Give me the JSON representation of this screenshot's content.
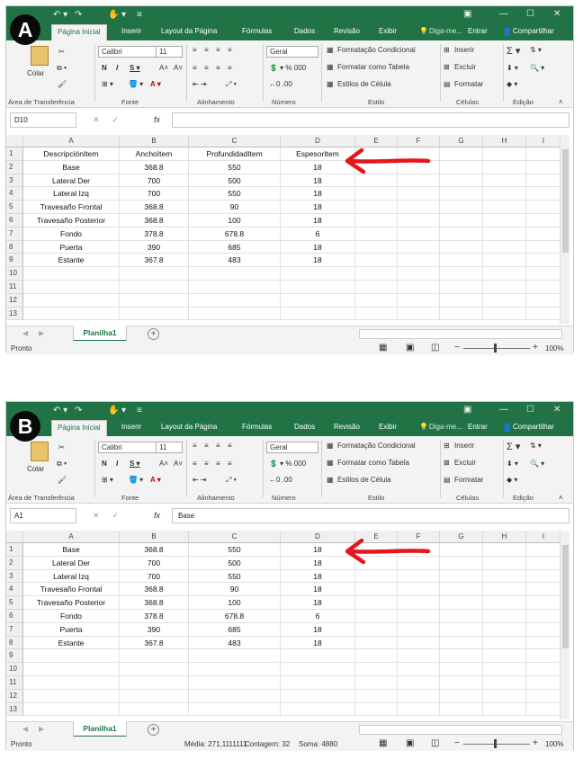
{
  "panels": [
    {
      "label": "A",
      "tabs": [
        "Página Inicial",
        "Inserir",
        "Layout da Página",
        "Fórmulas",
        "Dados",
        "Revisão",
        "Exibir"
      ],
      "tell_me": "Diga-me...",
      "signin": "Entrar",
      "share": "Compartilhar",
      "ribbon": {
        "paste": "Colar",
        "font_name": "Calibri",
        "font_size": "11",
        "number_format": "Geral",
        "cond_format": "Formatação Condicional",
        "format_table": "Formatar como Tabela",
        "cell_styles": "Estilos de Célula",
        "insert": "Inserir",
        "delete": "Excluir",
        "format": "Formatar",
        "groups": [
          "Área de Transferência",
          "Fonte",
          "Alinhamento",
          "Número",
          "Estilo",
          "Células",
          "Edição"
        ]
      },
      "name_box": "D10",
      "formula": "",
      "columns": [
        "A",
        "B",
        "C",
        "D",
        "E",
        "F",
        "G",
        "H",
        "I"
      ],
      "row_numbers": [
        "1",
        "2",
        "3",
        "4",
        "5",
        "6",
        "7",
        "8",
        "9",
        "10",
        "11",
        "12",
        "13"
      ],
      "rows": [
        [
          "DescripciónItem",
          "AnchoItem",
          "ProfundidadItem",
          "EspesorItem"
        ],
        [
          "Base",
          "368.8",
          "550",
          "18"
        ],
        [
          "Lateral Der",
          "700",
          "500",
          "18"
        ],
        [
          "Lateral Izq",
          "700",
          "550",
          "18"
        ],
        [
          "Travesaño Frontal",
          "368.8",
          "90",
          "18"
        ],
        [
          "Travesaño Posterior",
          "368.8",
          "100",
          "18"
        ],
        [
          "Fondo",
          "378.8",
          "678.8",
          "6"
        ],
        [
          "Puerta",
          "390",
          "685",
          "18"
        ],
        [
          "Estante",
          "367.8",
          "483",
          "18"
        ]
      ],
      "sheet": "Planilha1",
      "status": "Pronto",
      "stats": [],
      "zoom": "100%",
      "arrow_color": "#e8141b"
    },
    {
      "label": "B",
      "tabs": [
        "Página Inicial",
        "Inserir",
        "Layout da Página",
        "Fórmulas",
        "Dados",
        "Revisão",
        "Exibir"
      ],
      "tell_me": "Diga-me...",
      "signin": "Entrar",
      "share": "Compartilhar",
      "ribbon": {
        "paste": "Colar",
        "font_name": "Calibri",
        "font_size": "11",
        "number_format": "Geral",
        "cond_format": "Formatação Condicional",
        "format_table": "Formatar como Tabela",
        "cell_styles": "Estilos de Célula",
        "insert": "Inserir",
        "delete": "Excluir",
        "format": "Formatar",
        "groups": [
          "Área de Transferência",
          "Fonte",
          "Alinhamento",
          "Número",
          "Estilo",
          "Células",
          "Edição"
        ]
      },
      "name_box": "A1",
      "formula": "Base",
      "columns": [
        "A",
        "B",
        "C",
        "D",
        "E",
        "F",
        "G",
        "H",
        "I"
      ],
      "row_numbers": [
        "1",
        "2",
        "3",
        "4",
        "5",
        "6",
        "7",
        "8",
        "9",
        "10",
        "11",
        "12",
        "13"
      ],
      "rows": [
        [
          "Base",
          "368.8",
          "550",
          "18"
        ],
        [
          "Lateral Der",
          "700",
          "500",
          "18"
        ],
        [
          "Lateral Izq",
          "700",
          "550",
          "18"
        ],
        [
          "Travesaño Frontal",
          "368.8",
          "90",
          "18"
        ],
        [
          "Travesaño Posterior",
          "368.8",
          "100",
          "18"
        ],
        [
          "Fondo",
          "378.8",
          "678.8",
          "6"
        ],
        [
          "Puerta",
          "390",
          "685",
          "18"
        ],
        [
          "Estante",
          "367.8",
          "483",
          "18"
        ]
      ],
      "sheet": "Planilha1",
      "status": "Pronto",
      "stats": [
        "Média: 271,1111111",
        "Contagem: 32",
        "Soma: 4880"
      ],
      "zoom": "100%",
      "arrow_color": "#e8141b"
    }
  ]
}
